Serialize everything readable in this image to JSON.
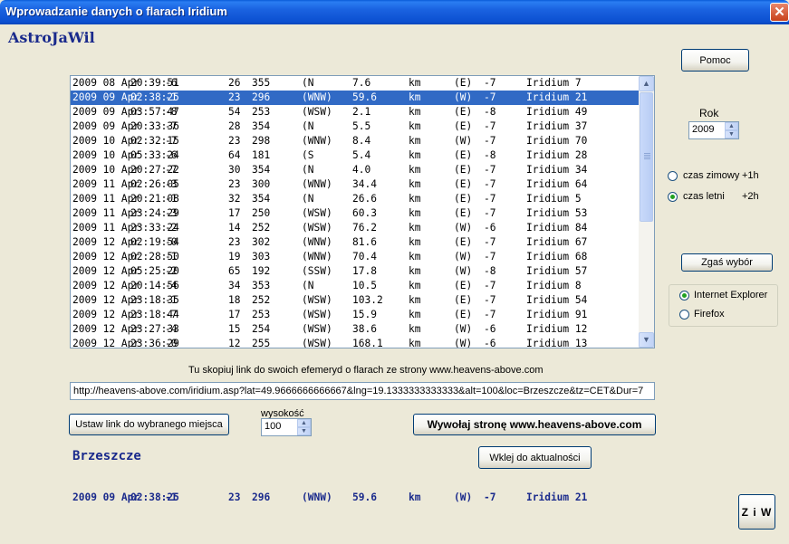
{
  "window": {
    "title": "Wprowadzanie danych o flarach Iridium",
    "close_glyph": "✕"
  },
  "brand": "AstroJaWil",
  "flares": [
    [
      "2009 08 Apr",
      "20:39:51",
      "-6",
      "26",
      "355",
      "(N",
      "7.6",
      "km",
      "(E)",
      "-7",
      "Iridium 7"
    ],
    [
      "2009 09 Apr",
      "02:38:25",
      "-1",
      "23",
      "296",
      "(WNW)",
      "59.6",
      "km",
      "(W)",
      "-7",
      "Iridium 21"
    ],
    [
      "2009 09 Apr",
      "03:57:47",
      "-8",
      "54",
      "253",
      "(WSW)",
      "2.1",
      "km",
      "(E)",
      "-8",
      "Iridium 49"
    ],
    [
      "2009 09 Apr",
      "20:33:36",
      "-7",
      "28",
      "354",
      "(N",
      "5.5",
      "km",
      "(E)",
      "-7",
      "Iridium 37"
    ],
    [
      "2009 10 Apr",
      "02:32:15",
      "-7",
      "23",
      "298",
      "(WNW)",
      "8.4",
      "km",
      "(W)",
      "-7",
      "Iridium 70"
    ],
    [
      "2009 10 Apr",
      "05:33:24",
      "-6",
      "64",
      "181",
      "(S",
      "5.4",
      "km",
      "(E)",
      "-8",
      "Iridium 28"
    ],
    [
      "2009 10 Apr",
      "20:27:22",
      "-7",
      "30",
      "354",
      "(N",
      "4.0",
      "km",
      "(E)",
      "-7",
      "Iridium 34"
    ],
    [
      "2009 11 Apr",
      "02:26:05",
      "-3",
      "23",
      "300",
      "(WNW)",
      "34.4",
      "km",
      "(E)",
      "-7",
      "Iridium 64"
    ],
    [
      "2009 11 Apr",
      "20:21:08",
      "-1",
      "32",
      "354",
      "(N",
      "26.6",
      "km",
      "(E)",
      "-7",
      "Iridium 5"
    ],
    [
      "2009 11 Apr",
      "23:24:29",
      "-3",
      "17",
      "250",
      "(WSW)",
      "60.3",
      "km",
      "(E)",
      "-7",
      "Iridium 53"
    ],
    [
      "2009 11 Apr",
      "23:33:24",
      "-2",
      "14",
      "252",
      "(WSW)",
      "76.2",
      "km",
      "(W)",
      "-6",
      "Iridium 84"
    ],
    [
      "2009 12 Apr",
      "02:19:54",
      "-0",
      "23",
      "302",
      "(WNW)",
      "81.6",
      "km",
      "(E)",
      "-7",
      "Iridium 67"
    ],
    [
      "2009 12 Apr",
      "02:28:50",
      "-1",
      "19",
      "303",
      "(WNW)",
      "70.4",
      "km",
      "(W)",
      "-7",
      "Iridium 68"
    ],
    [
      "2009 12 Apr",
      "05:25:20",
      "-2",
      "65",
      "192",
      "(SSW)",
      "17.8",
      "km",
      "(W)",
      "-8",
      "Iridium 57"
    ],
    [
      "2009 12 Apr",
      "20:14:56",
      "-4",
      "34",
      "353",
      "(N",
      "10.5",
      "km",
      "(E)",
      "-7",
      "Iridium 8"
    ],
    [
      "2009 12 Apr",
      "23:18:35",
      "-1",
      "18",
      "252",
      "(WSW)",
      "103.2",
      "km",
      "(E)",
      "-7",
      "Iridium 54"
    ],
    [
      "2009 12 Apr",
      "23:18:44",
      "-7",
      "17",
      "253",
      "(WSW)",
      "15.9",
      "km",
      "(E)",
      "-7",
      "Iridium 91"
    ],
    [
      "2009 12 Apr",
      "23:27:33",
      "-4",
      "15",
      "254",
      "(WSW)",
      "38.6",
      "km",
      "(W)",
      "-6",
      "Iridium 12"
    ],
    [
      "2009 12 Apr",
      "23:36:29",
      "-0",
      "12",
      "255",
      "(WSW)",
      "168.1",
      "km",
      "(W)",
      "-6",
      "Iridium 13"
    ]
  ],
  "selected_index": 1,
  "buttons": {
    "help": "Pomoc",
    "clear": "Zgaś wybór",
    "set_link": "Ustaw link do wybranego miejsca",
    "call_page": "Wywołaj stronę www.heavens-above.com",
    "paste_news": "Wklej do aktualności",
    "ziw": "Z i W"
  },
  "year": {
    "label": "Rok",
    "value": "2009"
  },
  "time_mode": {
    "winter_label": "czas zimowy",
    "winter_offset": "+1h",
    "summer_label": "czas letni",
    "summer_offset": "+2h",
    "selected": "summer"
  },
  "browser": {
    "options": [
      "Internet Explorer",
      "Firefox"
    ],
    "selected": "Internet Explorer"
  },
  "info_text": "Tu skopiuj link do swoich efemeryd o flarach ze strony  www.heavens-above.com",
  "url": "http://heavens-above.com/iridium.asp?lat=49.9666666666667&lng=19.1333333333333&alt=100&loc=Brzeszcze&tz=CET&Dur=7",
  "altitude": {
    "label": "wysokość",
    "value": "100"
  },
  "place": "Brzeszcze",
  "selected_flare": [
    "2009 09 Apr",
    "02:38:25",
    "-1",
    "23",
    "296",
    "(WNW)",
    "59.6",
    "km",
    "(W)",
    "-7",
    "Iridium 21"
  ],
  "colors": {
    "accent_text": "#1a2a8c",
    "selection": "#316ac5",
    "titlebar": "#0b4fd0"
  }
}
